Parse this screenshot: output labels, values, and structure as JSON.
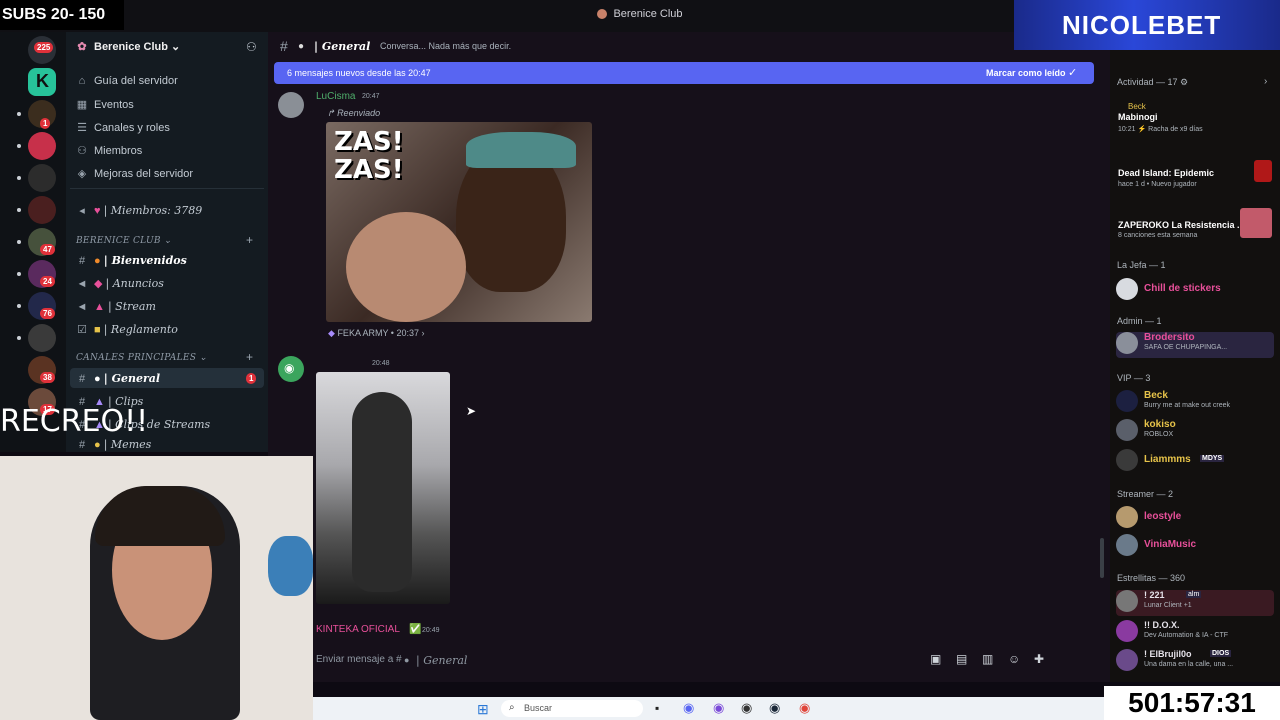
{
  "overlay": {
    "subs_counter": "SUBS 20- 150",
    "brand_banner": "NICOLEBET",
    "stream_timer": "501:57:31",
    "recreo_caption": "RECREO!!"
  },
  "window": {
    "title": "Berenice Club"
  },
  "rail": {
    "badges": [
      "225",
      "1",
      "24",
      "47",
      "24",
      "76",
      "38",
      "17"
    ]
  },
  "sidebar": {
    "server_name": "Berenice Club",
    "menu": [
      {
        "label": "Guía del servidor",
        "icon": "compass-icon"
      },
      {
        "label": "Eventos",
        "icon": "calendar-icon"
      },
      {
        "label": "Canales y roles",
        "icon": "list-icon"
      },
      {
        "label": "Miembros",
        "icon": "members-icon"
      },
      {
        "label": "Mejoras del servidor",
        "icon": "boost-icon"
      }
    ],
    "members_channel": "Miembros: 3789",
    "category1": "BERENICE CLUB",
    "channels1": [
      {
        "label": "Bienvenidos",
        "type": "#",
        "bold": true
      },
      {
        "label": "Anuncios",
        "type": "announce"
      },
      {
        "label": "Stream",
        "type": "announce"
      },
      {
        "label": "Reglamento",
        "type": "rules"
      }
    ],
    "category2": "CANALES PRINCIPALES",
    "channels2": [
      {
        "label": "General",
        "type": "#",
        "active": true,
        "badge": "1"
      },
      {
        "label": "Clips",
        "type": "#"
      },
      {
        "label": "Clips de Streams",
        "type": "#"
      },
      {
        "label": "Memes",
        "type": "#"
      }
    ]
  },
  "main": {
    "channel_name": "General",
    "channel_topic": "Conversa... Nada más que decir.",
    "banner_text": "6 mensajes nuevos desde las 20:47",
    "banner_action": "Marcar como leído",
    "messages": [
      {
        "author": "LuCisma",
        "time": "20:47",
        "forwarded_label": "Reenviado",
        "image_caption": "ZAS!\nZAS!",
        "forward_source": "FEKA ARMY",
        "forward_time": "20:37"
      },
      {
        "author": "",
        "time": "20:48"
      },
      {
        "author": "KINTEKA OFICIAL",
        "time": "20:49"
      }
    ],
    "composer_placeholder": "Enviar mensaje a #",
    "composer_channel": "General"
  },
  "members": {
    "activity_header": "Actividad — 17",
    "activities": [
      {
        "user": "Beck",
        "game": "Mabinogi",
        "time": "10:21",
        "detail": "Racha de x9 días",
        "color": "#e6c34a"
      },
      {
        "user": "Dead Island: Epidemic",
        "game": "Dead Island: Epidemic",
        "time": "hace 1 d",
        "detail": "Nuevo jugador",
        "color": "#e04848"
      },
      {
        "user": "ZAPEROKO La Resistencia ...",
        "game": "ZAPEROKO La Resistencia ...",
        "time": "",
        "detail": "8 canciones esta semana",
        "color": "#e6e3ea"
      }
    ],
    "sections": [
      {
        "title": "La Jefa — 1",
        "members": [
          {
            "name": "Chill de stickers",
            "sub": "",
            "color": "#e8509a"
          }
        ]
      },
      {
        "title": "Admin — 1",
        "members": [
          {
            "name": "Brodersito",
            "sub": "SAFA OE CHUPAPINGA...",
            "color": "#e8509a"
          }
        ]
      },
      {
        "title": "VIP — 3",
        "members": [
          {
            "name": "Beck",
            "sub": "Burry me at make out creek",
            "color": "#e6c34a"
          },
          {
            "name": "kokiso",
            "sub": "ROBLOX",
            "color": "#e6c34a"
          },
          {
            "name": "Liammms",
            "sub": "",
            "tag": "MDYS",
            "color": "#e6c34a"
          }
        ]
      },
      {
        "title": "Streamer — 2",
        "members": [
          {
            "name": "leostyle",
            "sub": "",
            "color": "#e8509a"
          },
          {
            "name": "ViniaMusic",
            "sub": "",
            "color": "#e8509a"
          }
        ]
      },
      {
        "title": "Estrellitas — 360",
        "members": [
          {
            "name": "! 221",
            "sub": "Lunar Client +1",
            "tag": "alm",
            "color": "#e6e3ea"
          },
          {
            "name": "!! D.O.X.",
            "sub": "Dev Automation & IA - CTF",
            "color": "#e6e3ea"
          },
          {
            "name": "! ElBrujil0o",
            "sub": "Una dama en la calle, una ...",
            "tag": "DIOS",
            "color": "#e6e3ea"
          }
        ]
      }
    ]
  },
  "taskbar": {
    "search_placeholder": "Buscar"
  },
  "colors": {
    "accent": "#5865f2",
    "brand_blue": "#2a47d8",
    "unread_red": "#e0313a"
  }
}
